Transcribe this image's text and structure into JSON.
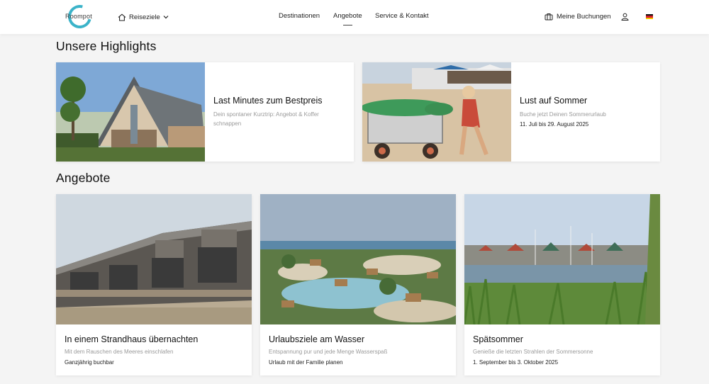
{
  "header": {
    "logo_text": "Roompot",
    "reiseziele_label": "Reiseziele",
    "nav": [
      "Destinationen",
      "Angebote",
      "Service & Kontakt"
    ],
    "meine_buchungen": "Meine Buchungen",
    "language": "DE"
  },
  "highlights": {
    "title": "Unsere Highlights",
    "cards": [
      {
        "title": "Last Minutes zum Bestpreis",
        "subtitle": "Dein spontaner Kurztrip: Angebot & Koffer schnappen",
        "extra": ""
      },
      {
        "title": "Lust auf Sommer",
        "subtitle": "Buche jetzt Deinen Sommerurlaub",
        "extra": "11. Juli bis 29. August 2025"
      }
    ]
  },
  "angebote": {
    "title": "Angebote",
    "cards": [
      {
        "title": "In einem Strandhaus übernachten",
        "subtitle": "Mit dem Rauschen des Meeres einschlafen",
        "extra": "Ganzjährig buchbar"
      },
      {
        "title": "Urlaubsziele am Wasser",
        "subtitle": "Entspannung pur und jede Menge Wasserspaß",
        "extra": "Urlaub mit der Familie planen"
      },
      {
        "title": "Spätsommer",
        "subtitle": "Genieße die letzten Strahlen der Sommersonne",
        "extra": "1. September bis 3. Oktober 2025"
      }
    ]
  },
  "colors": {
    "accent": "#3bb3c9",
    "text": "#1d1d1d",
    "muted": "#9a9a9a",
    "background": "#f4f4f4"
  }
}
